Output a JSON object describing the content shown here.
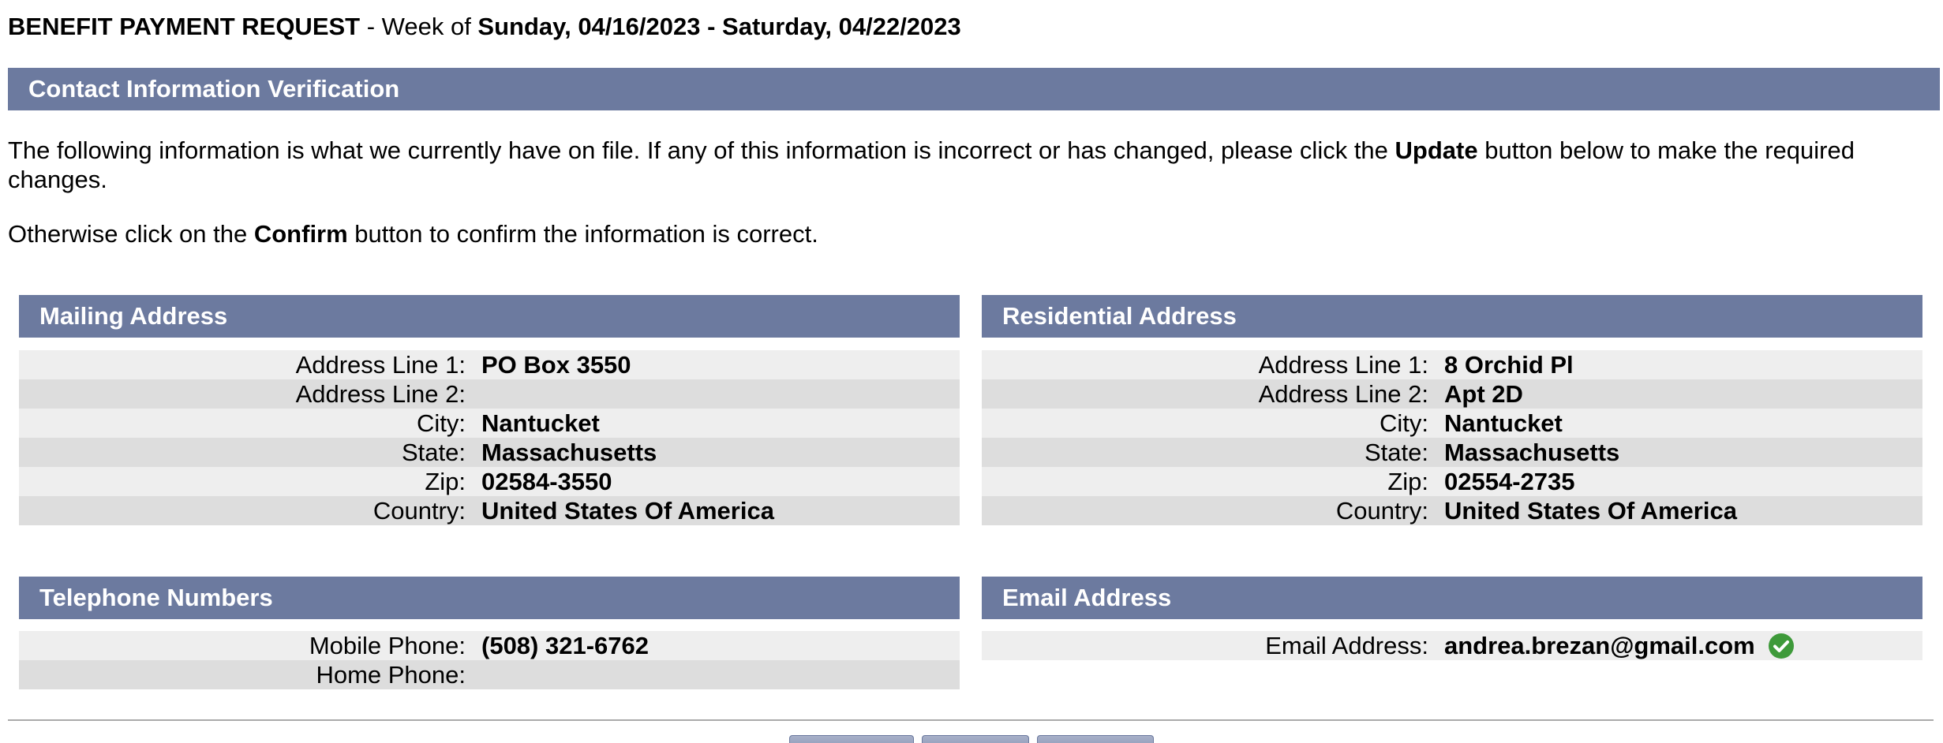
{
  "header": {
    "title_bold": "BENEFIT PAYMENT REQUEST",
    "title_mid": " - Week of ",
    "start_date": "Sunday, 04/16/2023",
    "dash": " - ",
    "end_date": "Saturday, 04/22/2023"
  },
  "contact_section": {
    "title": "Contact Information Verification",
    "para1_pre": "The following information is what we currently have on file. If any of this information is incorrect or has changed, please click the ",
    "para1_bold": "Update",
    "para1_post": " button below to make the required changes.",
    "para2_pre": "Otherwise click on the ",
    "para2_bold": "Confirm",
    "para2_post": " button to confirm the information is correct."
  },
  "mailing": {
    "title": "Mailing Address",
    "rows": [
      {
        "label": "Address Line 1:",
        "value": "PO Box 3550"
      },
      {
        "label": "Address Line 2:",
        "value": ""
      },
      {
        "label": "City:",
        "value": "Nantucket"
      },
      {
        "label": "State:",
        "value": "Massachusetts"
      },
      {
        "label": "Zip:",
        "value": "02584-3550"
      },
      {
        "label": "Country:",
        "value": "United States Of America"
      }
    ]
  },
  "residential": {
    "title": "Residential Address",
    "rows": [
      {
        "label": "Address Line 1:",
        "value": "8 Orchid Pl"
      },
      {
        "label": "Address Line 2:",
        "value": "Apt 2D"
      },
      {
        "label": "City:",
        "value": "Nantucket"
      },
      {
        "label": "State:",
        "value": "Massachusetts"
      },
      {
        "label": "Zip:",
        "value": "02554-2735"
      },
      {
        "label": "Country:",
        "value": "United States Of America"
      }
    ]
  },
  "telephone": {
    "title": "Telephone Numbers",
    "rows": [
      {
        "label": "Mobile Phone:",
        "value": "(508) 321-6762"
      },
      {
        "label": "Home Phone:",
        "value": ""
      }
    ]
  },
  "email": {
    "title": "Email Address",
    "rows": [
      {
        "label": "Email Address:",
        "value": "andrea.brezan@gmail.com"
      }
    ],
    "verified_icon": "check-circle-icon"
  },
  "colors": {
    "section_bar": "#6c7a9f",
    "row_light": "#eeeeee",
    "row_dark": "#dddddd",
    "verified_green": "#3e9a3a"
  }
}
